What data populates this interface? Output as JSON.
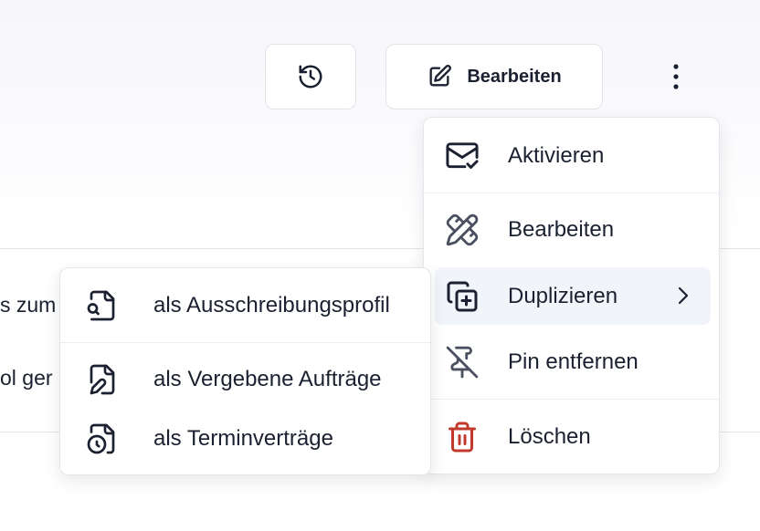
{
  "toolbar": {
    "history_icon": "history-icon",
    "edit_button_label": "Bearbeiten",
    "more_icon": "kebab-menu-icon"
  },
  "background_rows": [
    {
      "text": "s zum"
    },
    {
      "text": "ol ger"
    }
  ],
  "actions_menu": {
    "items": [
      {
        "label": "Aktivieren",
        "icon": "mail-check-icon"
      },
      {
        "label": "Bearbeiten",
        "icon": "pencil-ruler-icon"
      },
      {
        "label": "Duplizieren",
        "icon": "copy-plus-icon",
        "has_submenu": true,
        "highlighted": true
      },
      {
        "label": "Pin entfernen",
        "icon": "pin-off-icon"
      },
      {
        "label": "Löschen",
        "icon": "trash-icon",
        "color": "#c0392b"
      }
    ]
  },
  "duplicate_submenu": {
    "items": [
      {
        "label": "als Ausschreibungsprofil",
        "icon": "file-search-icon"
      },
      {
        "label": "als Vergebene Aufträge",
        "icon": "file-pen-icon"
      },
      {
        "label": "als Terminverträge",
        "icon": "file-clock-icon"
      }
    ]
  },
  "colors": {
    "text": "#1b2130",
    "icon": "#4a5060",
    "danger": "#c0392b",
    "border": "#e1e3e8",
    "hover_bg": "#f1f4f9"
  }
}
